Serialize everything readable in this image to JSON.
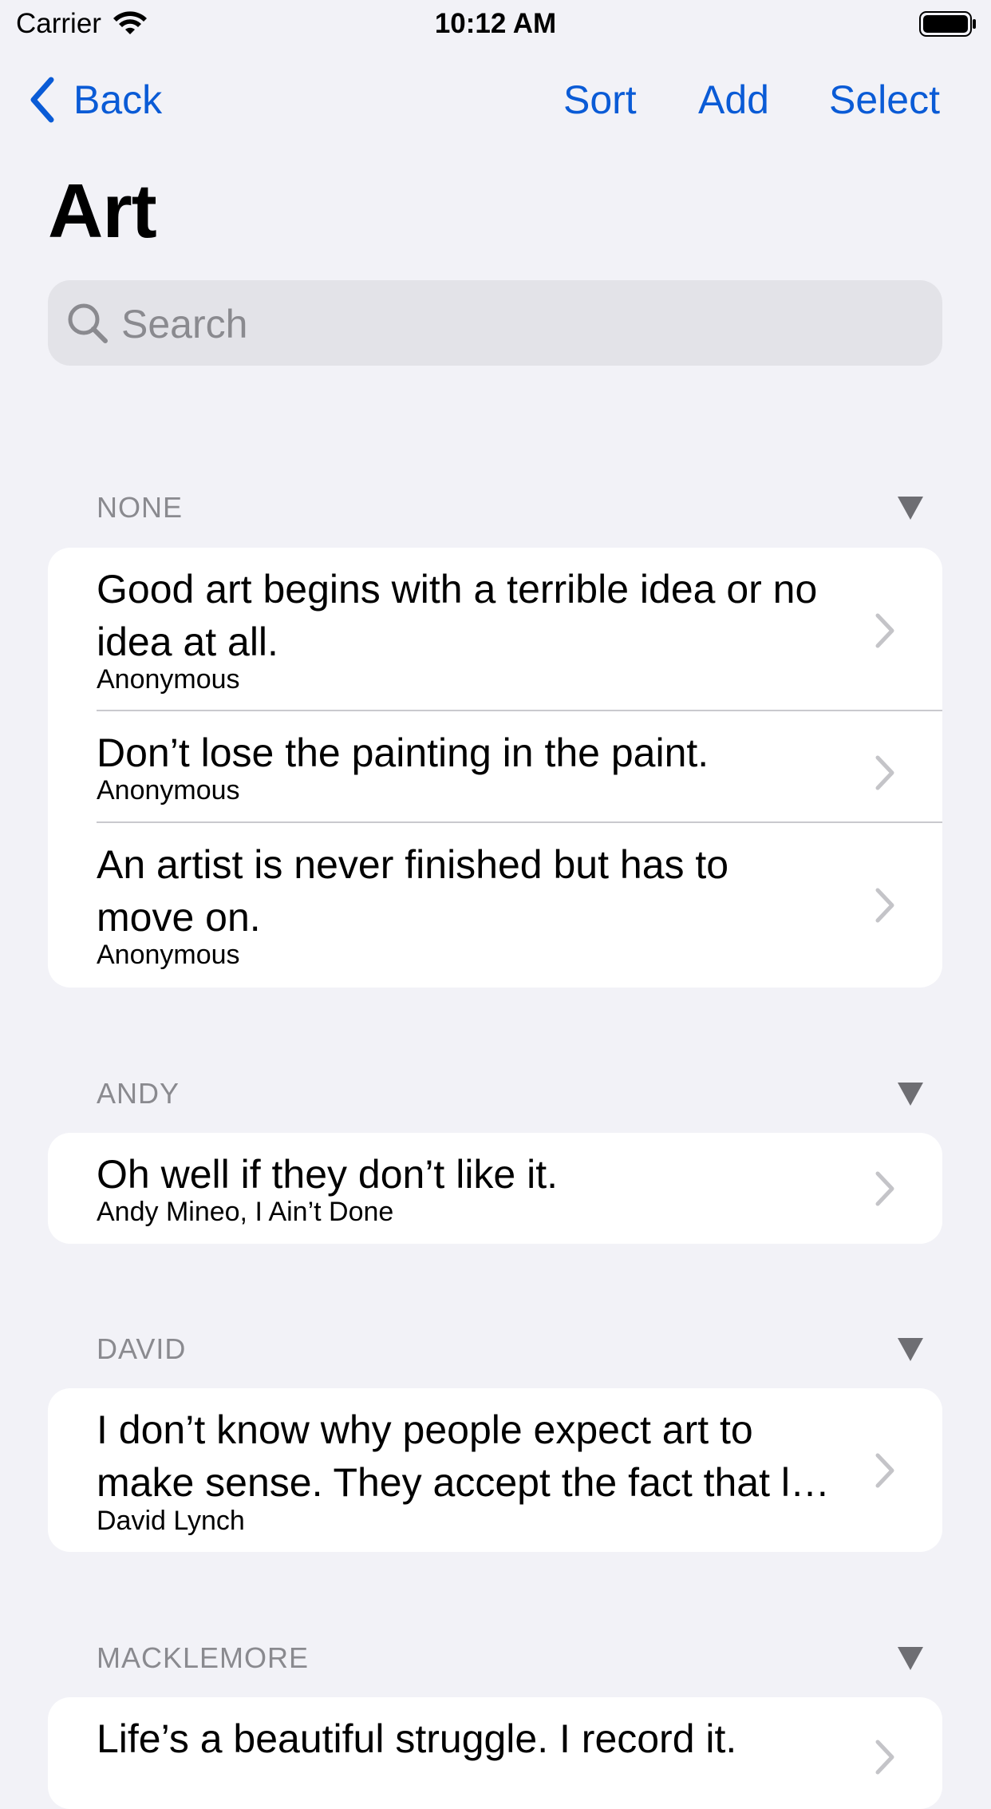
{
  "status": {
    "carrier": "Carrier",
    "time": "10:12 AM"
  },
  "nav": {
    "back_label": "Back",
    "sort_label": "Sort",
    "add_label": "Add",
    "select_label": "Select"
  },
  "page": {
    "title": "Art"
  },
  "search": {
    "placeholder": "Search"
  },
  "sections": [
    {
      "header": "NONE",
      "rows": [
        {
          "quote": "Good art begins with a terrible idea or no idea at all.",
          "author": "Anonymous"
        },
        {
          "quote": "Don’t lose the painting in the paint.",
          "author": "Anonymous"
        },
        {
          "quote": "An artist is never finished but has to move on.",
          "author": "Anonymous"
        }
      ]
    },
    {
      "header": "ANDY",
      "rows": [
        {
          "quote": "Oh well if they don’t like it.",
          "author": "Andy Mineo, I Ain’t Done"
        }
      ]
    },
    {
      "header": "DAVID",
      "rows": [
        {
          "quote_line1": "I don’t know why people expect art to",
          "quote_line2": "make sense. They accept the fact that l…",
          "author": "David Lynch"
        }
      ]
    },
    {
      "header": "MACKLEMORE",
      "rows": [
        {
          "quote": "Life’s a beautiful struggle. I record it."
        }
      ]
    }
  ],
  "colors": {
    "accent": "#0a5bd6",
    "background": "#f2f2f7",
    "secondary_text": "#8a8a8f"
  }
}
